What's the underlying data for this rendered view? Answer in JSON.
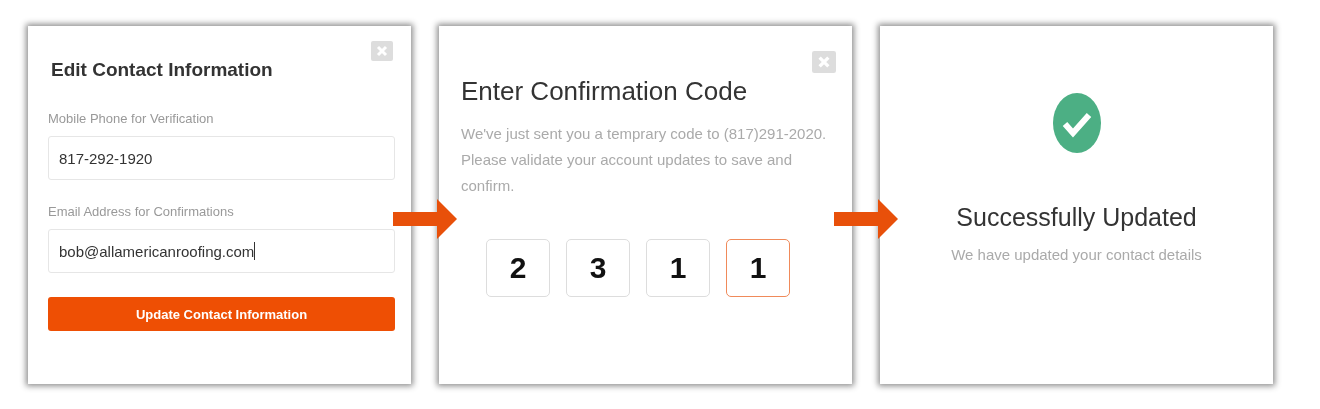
{
  "panels": [
    {
      "kind": "form",
      "title": "Edit Contact Information",
      "fields": [
        {
          "label": "Mobile Phone for Verification",
          "value": "817-292-1920",
          "focused": false
        },
        {
          "label": "Email Address for Confirmations",
          "value": "bob@allamericanroofing.com",
          "focused": true
        }
      ],
      "button": "Update Contact Information"
    },
    {
      "kind": "code",
      "title": "Enter Confirmation Code",
      "message": "We've just sent you a temprary code to (817)291-2020. Please validate your account updates to save and confirm.",
      "digits": [
        {
          "value": "2",
          "selected": false
        },
        {
          "value": "3",
          "selected": false
        },
        {
          "value": "1",
          "selected": false
        },
        {
          "value": "1",
          "selected": true
        }
      ]
    },
    {
      "kind": "success",
      "title": "Successfully Updated",
      "message": "We have updated your contact details"
    }
  ]
}
